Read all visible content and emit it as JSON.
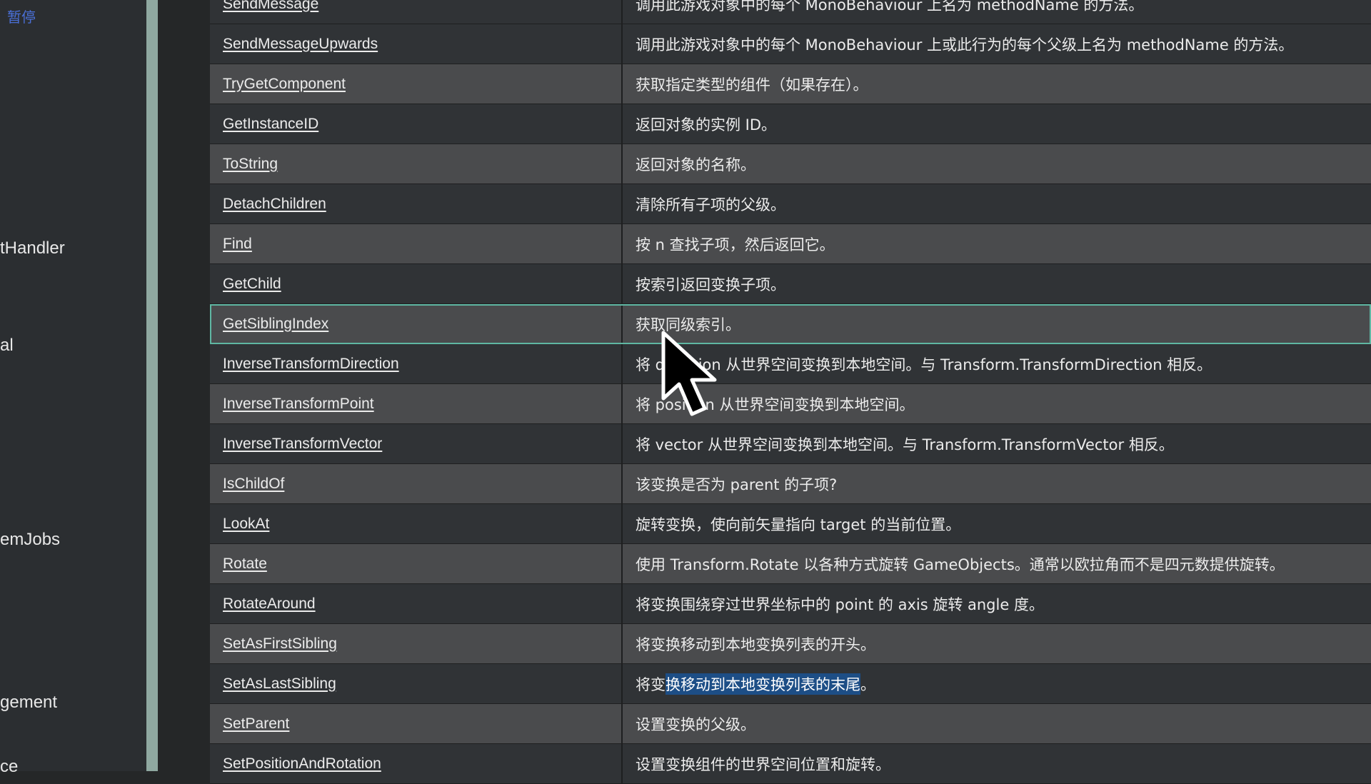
{
  "overlay": {
    "paused": "暂停"
  },
  "sidebar": {
    "items": [
      {
        "label": "tHandler"
      },
      {
        "label": "al"
      },
      {
        "label": "emJobs"
      },
      {
        "label": "gement"
      },
      {
        "label": "ce"
      }
    ]
  },
  "methods": [
    {
      "name": "SendMessage",
      "desc": "调用此游戏对象中的每个 MonoBehaviour 上名为 methodName 的方法。"
    },
    {
      "name": "SendMessageUpwards",
      "desc": "调用此游戏对象中的每个 MonoBehaviour 上或此行为的每个父级上名为 methodName 的方法。"
    },
    {
      "name": "TryGetComponent",
      "desc": "获取指定类型的组件（如果存在）。"
    },
    {
      "name": "GetInstanceID",
      "desc": "返回对象的实例 ID。"
    },
    {
      "name": "ToString",
      "desc": "返回对象的名称。"
    },
    {
      "name": "DetachChildren",
      "desc": "清除所有子项的父级。"
    },
    {
      "name": "Find",
      "desc": "按 n 查找子项，然后返回它。"
    },
    {
      "name": "GetChild",
      "desc": "按索引返回变换子项。"
    },
    {
      "name": "GetSiblingIndex",
      "desc": "获取同级索引。"
    },
    {
      "name": "InverseTransformDirection",
      "desc": "将 direction 从世界空间变换到本地空间。与 Transform.TransformDirection 相反。"
    },
    {
      "name": "InverseTransformPoint",
      "desc": "将 position 从世界空间变换到本地空间。"
    },
    {
      "name": "InverseTransformVector",
      "desc": "将 vector 从世界空间变换到本地空间。与 Transform.TransformVector 相反。"
    },
    {
      "name": "IsChildOf",
      "desc": "该变换是否为 parent 的子项?"
    },
    {
      "name": "LookAt",
      "desc": "旋转变换，使向前矢量指向 target 的当前位置。"
    },
    {
      "name": "Rotate",
      "desc": "使用 Transform.Rotate 以各种方式旋转 GameObjects。通常以欧拉角而不是四元数提供旋转。"
    },
    {
      "name": "RotateAround",
      "desc": "将变换围绕穿过世界坐标中的 point 的 axis 旋转 angle 度。"
    },
    {
      "name": "SetAsFirstSibling",
      "desc": "将变换移动到本地变换列表的开头。"
    },
    {
      "name": "SetAsLastSibling",
      "desc_before": "将变",
      "desc_selected": "换移动到本地变换列表的末尾",
      "desc_after": "。"
    },
    {
      "name": "SetParent",
      "desc": "设置变换的父级。"
    },
    {
      "name": "SetPositionAndRotation",
      "desc": "设置变换组件的世界空间位置和旋转。"
    }
  ],
  "colors": {
    "row_dark": "#303336",
    "row_light": "#4a4b4d",
    "highlight_border": "#5fb7a3",
    "selection": "#1d4e86"
  },
  "cursor": {
    "icon": "mouse-pointer-icon"
  }
}
